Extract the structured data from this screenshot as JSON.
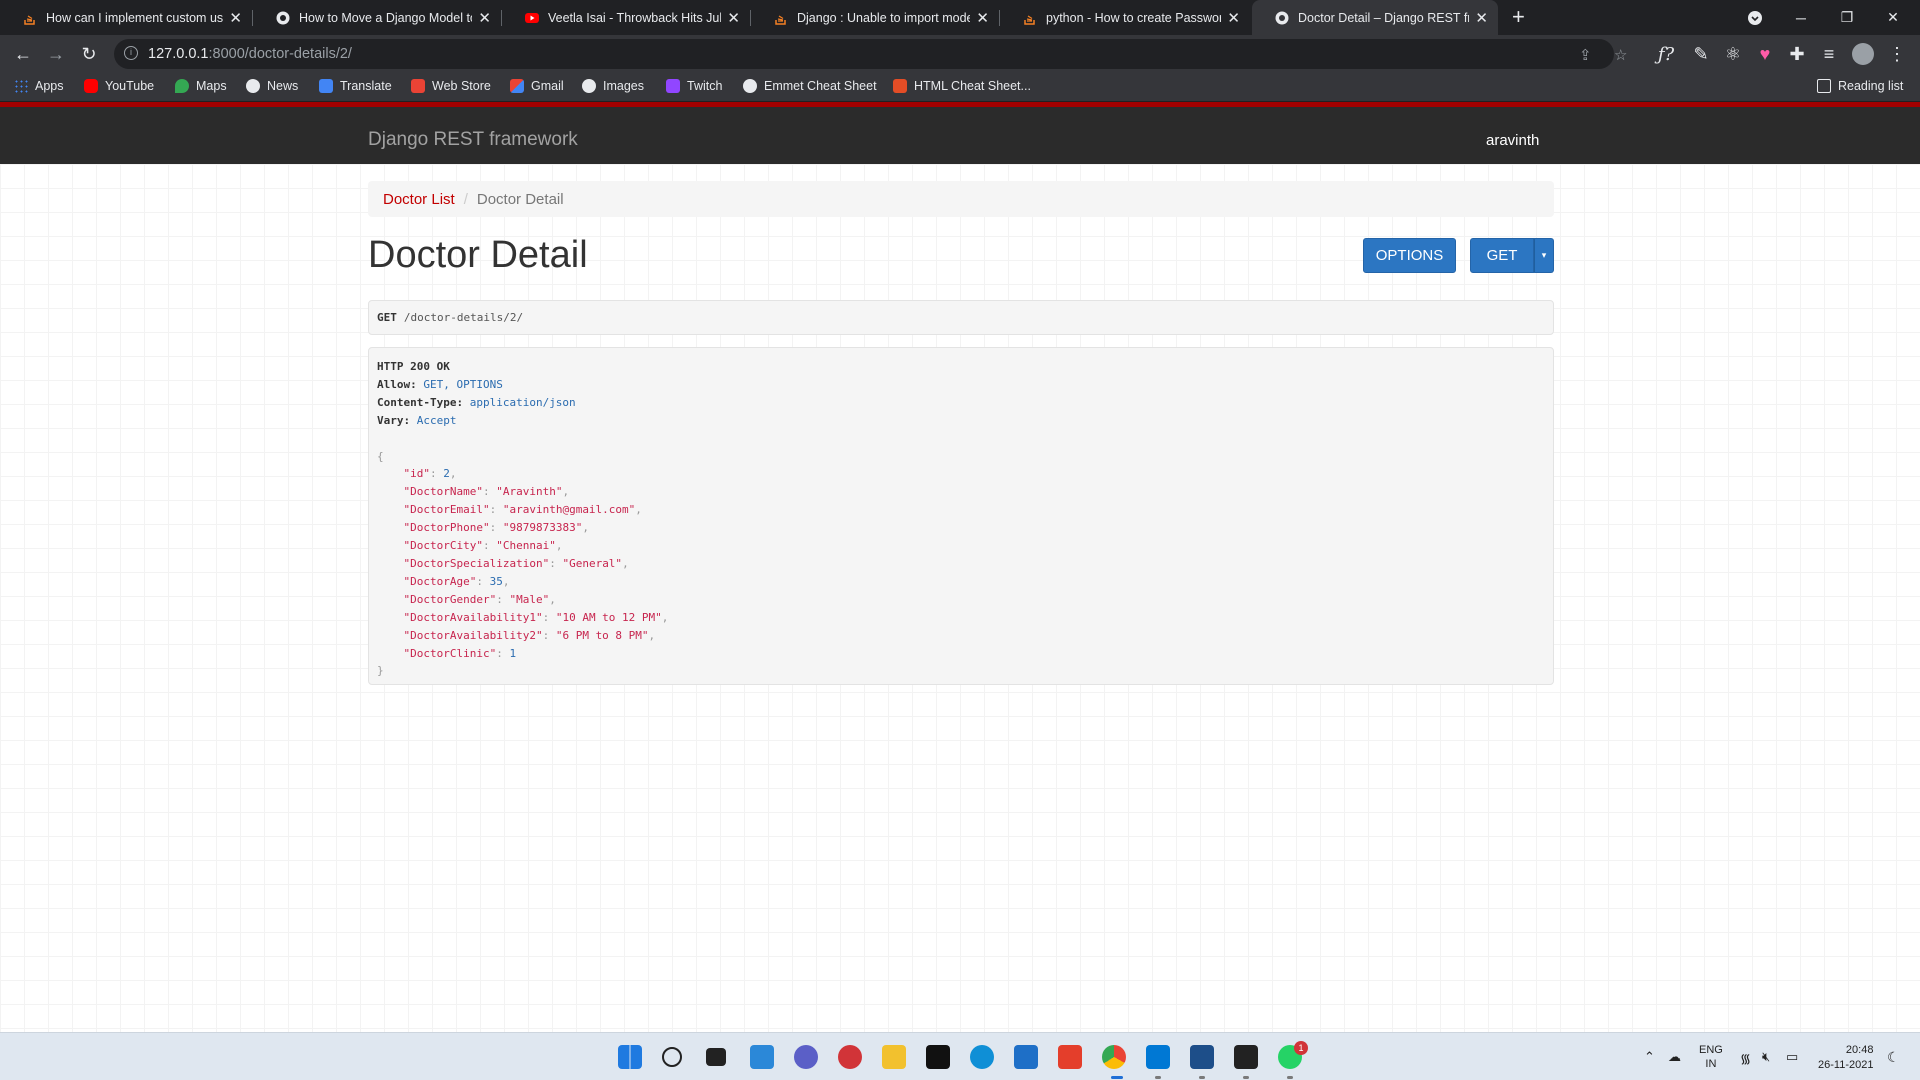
{
  "browser": {
    "tabs": [
      {
        "title": "How can I implement custom use"
      },
      {
        "title": "How to Move a Django Model to"
      },
      {
        "title": "Veetla Isai - Throwback Hits Juke"
      },
      {
        "title": "Django : Unable to import mode"
      },
      {
        "title": "python - How to create Passwor"
      },
      {
        "title": "Doctor Detail – Django REST fran"
      }
    ],
    "url_host": "127.0.0.1",
    "url_rest": ":8000/doctor-details/2/",
    "bookmarks": [
      "Apps",
      "YouTube",
      "Maps",
      "News",
      "Translate",
      "Web Store",
      "Gmail",
      "Images",
      "Twitch",
      "Emmet Cheat Sheet",
      "HTML Cheat Sheet..."
    ],
    "reading_list": "Reading list",
    "colors": {
      "chrome_dark": "#202124",
      "chrome_bar": "#35363a"
    }
  },
  "drf": {
    "brand": "Django REST framework",
    "user": "aravinth",
    "accent": "#a30000"
  },
  "breadcrumb": {
    "list_label": "Doctor List",
    "separator": "/",
    "current": "Doctor Detail"
  },
  "page_title": "Doctor Detail",
  "buttons": {
    "options": "OPTIONS",
    "get": "GET",
    "caret": "▾",
    "color": "#2c76c2"
  },
  "request": {
    "method": "GET",
    "path": "/doctor-details/2/"
  },
  "response": {
    "status": "HTTP 200 OK",
    "headers": [
      {
        "key": "Allow:",
        "value": "GET, OPTIONS"
      },
      {
        "key": "Content-Type:",
        "value": "application/json"
      },
      {
        "key": "Vary:",
        "value": "Accept"
      }
    ],
    "json_open": "{",
    "json_close": "}",
    "body": [
      {
        "key": "\"id\"",
        "value": "2",
        "kind": "num"
      },
      {
        "key": "\"DoctorName\"",
        "value": "\"Aravinth\"",
        "kind": "str"
      },
      {
        "key": "\"DoctorEmail\"",
        "value": "\"aravinth@gmail.com\"",
        "kind": "str"
      },
      {
        "key": "\"DoctorPhone\"",
        "value": "\"9879873383\"",
        "kind": "str"
      },
      {
        "key": "\"DoctorCity\"",
        "value": "\"Chennai\"",
        "kind": "str"
      },
      {
        "key": "\"DoctorSpecialization\"",
        "value": "\"General\"",
        "kind": "str"
      },
      {
        "key": "\"DoctorAge\"",
        "value": "35",
        "kind": "num"
      },
      {
        "key": "\"DoctorGender\"",
        "value": "\"Male\"",
        "kind": "str"
      },
      {
        "key": "\"DoctorAvailability1\"",
        "value": "\"10 AM to 12 PM\"",
        "kind": "str"
      },
      {
        "key": "\"DoctorAvailability2\"",
        "value": "\"6 PM to 8 PM\"",
        "kind": "str"
      },
      {
        "key": "\"DoctorClinic\"",
        "value": "1",
        "kind": "num"
      }
    ]
  },
  "taskbar": {
    "lang": "ENG",
    "region": "IN",
    "time": "20:48",
    "date": "26-11-2021",
    "notification_count": "1"
  }
}
